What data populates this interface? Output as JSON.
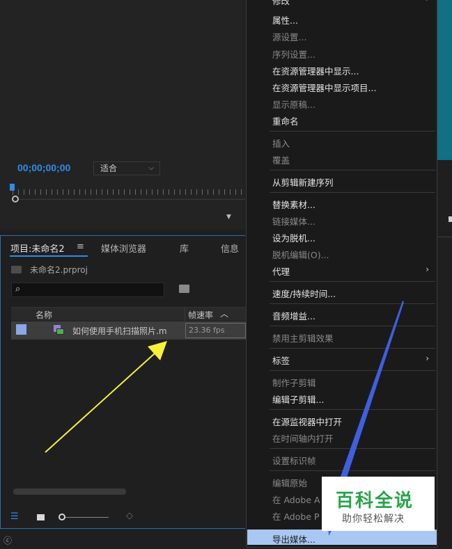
{
  "monitor": {
    "timecode": "00;00;00;00",
    "fit_select": "适合"
  },
  "project_panel": {
    "tabs": [
      "项目:未命名2",
      "媒体浏览器",
      "库",
      "信息"
    ],
    "menu_glyph": "≡",
    "project_file": "未命名2.prproj",
    "columns": {
      "name": "名称",
      "fps": "帧速率"
    },
    "items": [
      {
        "name": "如何使用手机扫描照片.m",
        "fps": "23.36 fps"
      }
    ]
  },
  "context_menu": {
    "items": [
      {
        "label": "修改",
        "disabled": false,
        "submenu": true
      },
      {
        "label": "属性...",
        "disabled": false
      },
      {
        "label": "源设置...",
        "disabled": true
      },
      {
        "label": "序列设置...",
        "disabled": true
      },
      {
        "label": "在资源管理器中显示...",
        "disabled": false
      },
      {
        "label": "在资源管理器中显示项目...",
        "disabled": false
      },
      {
        "label": "显示原稿...",
        "disabled": true
      },
      {
        "label": "重命名",
        "disabled": false
      },
      {
        "label": "插入",
        "disabled": true
      },
      {
        "label": "覆盖",
        "disabled": true
      },
      {
        "label": "从剪辑新建序列",
        "disabled": false
      },
      {
        "label": "替换素材...",
        "disabled": false
      },
      {
        "label": "链接媒体...",
        "disabled": true
      },
      {
        "label": "设为脱机...",
        "disabled": false
      },
      {
        "label": "脱机编辑(O)...",
        "disabled": true
      },
      {
        "label": "代理",
        "disabled": false,
        "submenu": true
      },
      {
        "label": "速度/持续时间...",
        "disabled": false
      },
      {
        "label": "音频增益...",
        "disabled": false
      },
      {
        "label": "禁用主剪辑效果",
        "disabled": true
      },
      {
        "label": "标签",
        "disabled": false,
        "submenu": true
      },
      {
        "label": "制作子剪辑",
        "disabled": true
      },
      {
        "label": "编辑子剪辑...",
        "disabled": false
      },
      {
        "label": "在源监视器中打开",
        "disabled": false
      },
      {
        "label": "在时间轴内打开",
        "disabled": true
      },
      {
        "label": "设置标识帧",
        "disabled": true
      },
      {
        "label": "编辑原始",
        "disabled": true
      },
      {
        "label": "在 Adobe A",
        "disabled": true
      },
      {
        "label": "在 Adobe P",
        "disabled": true
      },
      {
        "label": "导出媒体...",
        "disabled": false,
        "highlighted": true
      }
    ]
  },
  "watermark": {
    "title": "百科全说",
    "subtitle": "助你轻松解决"
  },
  "colors": {
    "accent": "#2d8ceb",
    "highlight": "#a8c7f2",
    "annotation_yellow": "#f5f23a",
    "annotation_blue": "#3f5fe0",
    "watermark_green": "#27a54a"
  }
}
